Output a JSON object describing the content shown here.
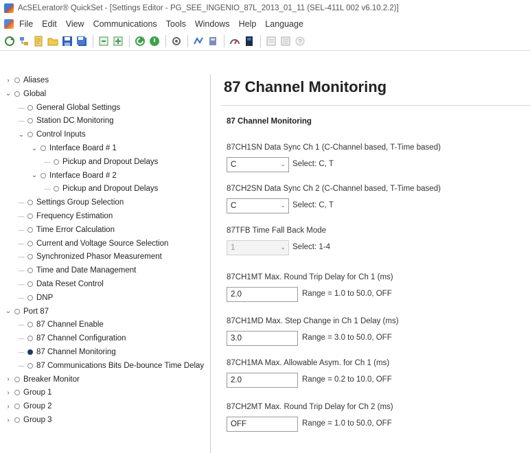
{
  "window": {
    "title": "AcSELerator® QuickSet - [Settings Editor - PG_SEE_INGENIO_87L_2013_01_11 (SEL-411L 002 v6.10.2.2)]"
  },
  "menu": [
    "File",
    "Edit",
    "View",
    "Communications",
    "Tools",
    "Windows",
    "Help",
    "Language"
  ],
  "toolbar": {
    "icons": [
      "refresh-icon",
      "tree-icon",
      "document-icon",
      "open-folder-icon",
      "save-icon",
      "save-all-icon",
      "read-icon",
      "send-icon",
      "connect-icon",
      "disconnect-icon",
      "settings-icon",
      "events-icon",
      "meter-icon",
      "terminal-icon",
      "hmi-icon",
      "report-icon",
      "help-icon"
    ]
  },
  "tree": [
    {
      "label": "Aliases",
      "level": 0,
      "expander": "›"
    },
    {
      "label": "Global",
      "level": 0,
      "expander": "⌄"
    },
    {
      "label": "General Global Settings",
      "level": 1,
      "expander": ""
    },
    {
      "label": "Station DC Monitoring",
      "level": 1,
      "expander": ""
    },
    {
      "label": "Control Inputs",
      "level": 1,
      "expander": "⌄"
    },
    {
      "label": "Interface Board # 1",
      "level": 2,
      "expander": "⌄"
    },
    {
      "label": "Pickup and Dropout Delays",
      "level": 3,
      "expander": ""
    },
    {
      "label": "Interface Board # 2",
      "level": 2,
      "expander": "⌄"
    },
    {
      "label": "Pickup and Dropout Delays",
      "level": 3,
      "expander": ""
    },
    {
      "label": "Settings Group Selection",
      "level": 1,
      "expander": ""
    },
    {
      "label": "Frequency Estimation",
      "level": 1,
      "expander": ""
    },
    {
      "label": "Time Error Calculation",
      "level": 1,
      "expander": ""
    },
    {
      "label": "Current and Voltage Source Selection",
      "level": 1,
      "expander": ""
    },
    {
      "label": "Synchronized Phasor Measurement",
      "level": 1,
      "expander": ""
    },
    {
      "label": "Time and Date Management",
      "level": 1,
      "expander": ""
    },
    {
      "label": "Data Reset Control",
      "level": 1,
      "expander": ""
    },
    {
      "label": "DNP",
      "level": 1,
      "expander": ""
    },
    {
      "label": "Port 87",
      "level": 0,
      "expander": "⌄"
    },
    {
      "label": "87 Channel Enable",
      "level": 1,
      "expander": ""
    },
    {
      "label": "87 Channel Configuration",
      "level": 1,
      "expander": ""
    },
    {
      "label": "87 Channel Monitoring",
      "level": 1,
      "expander": "",
      "selected": true
    },
    {
      "label": "87 Communications Bits De-bounce Time Delay",
      "level": 1,
      "expander": ""
    },
    {
      "label": "Breaker Monitor",
      "level": 0,
      "expander": "›"
    },
    {
      "label": "Group 1",
      "level": 0,
      "expander": "›"
    },
    {
      "label": "Group 2",
      "level": 0,
      "expander": "›"
    },
    {
      "label": "Group 3",
      "level": 0,
      "expander": "›"
    }
  ],
  "main": {
    "title": "87 Channel Monitoring",
    "section": "87 Channel Monitoring",
    "fields": [
      {
        "label": "87CH1SN  Data Sync Ch 1 (C-Channel based, T-Time based)",
        "value": "C",
        "hint": "Select: C, T",
        "kind": "select"
      },
      {
        "label": "87CH2SN  Data Sync Ch 2 (C-Channel based, T-Time based)",
        "value": "C",
        "hint": "Select: C, T",
        "kind": "select"
      },
      {
        "label": "87TFB  Time Fall Back Mode",
        "value": "1",
        "hint": "Select: 1-4",
        "kind": "select-disabled"
      },
      {
        "label": "87CH1MT  Max. Round Trip Delay for Ch 1 (ms)",
        "value": "2.0",
        "hint": "Range = 1.0 to 50.0, OFF",
        "kind": "text"
      },
      {
        "label": "87CH1MD  Max. Step Change in Ch 1 Delay (ms)",
        "value": "3.0",
        "hint": "Range = 3.0 to 50.0, OFF",
        "kind": "text"
      },
      {
        "label": "87CH1MA  Max. Allowable Asym. for Ch 1 (ms)",
        "value": "2.0",
        "hint": "Range = 0.2 to 10.0, OFF",
        "kind": "text"
      },
      {
        "label": "87CH2MT  Max. Round Trip Delay for Ch 2 (ms)",
        "value": "OFF",
        "hint": "Range = 1.0 to 50.0, OFF",
        "kind": "text"
      }
    ]
  }
}
